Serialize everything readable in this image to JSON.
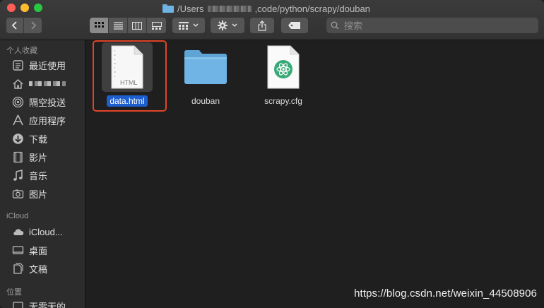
{
  "window": {
    "title_prefix": "/Users",
    "title_suffix": ",code/python/scrapy/douban"
  },
  "toolbar": {
    "back_icon": "chevron-left-icon",
    "forward_icon": "chevron-right-icon",
    "view_modes": [
      "icon-view",
      "list-view",
      "column-view",
      "gallery-view"
    ],
    "active_view": "icon-view",
    "search_placeholder": "搜索"
  },
  "sidebar": {
    "favorites_header": "个人收藏",
    "favorites": [
      {
        "label": "最近使用",
        "icon": "recents-icon"
      },
      {
        "label": "",
        "icon": "home-icon"
      },
      {
        "label": "隔空投送",
        "icon": "airdrop-icon"
      },
      {
        "label": "应用程序",
        "icon": "applications-icon"
      },
      {
        "label": "下载",
        "icon": "downloads-icon"
      },
      {
        "label": "影片",
        "icon": "movies-icon"
      },
      {
        "label": "音乐",
        "icon": "music-icon"
      },
      {
        "label": "图片",
        "icon": "pictures-icon"
      }
    ],
    "icloud_header": "iCloud",
    "icloud": [
      {
        "label": "iCloud...",
        "icon": "icloud-drive-icon"
      },
      {
        "label": "桌面",
        "icon": "desktop-icon"
      },
      {
        "label": "文稿",
        "icon": "documents-icon"
      }
    ],
    "locations_header": "位置",
    "locations": [
      {
        "label": "无零无的",
        "icon": "network-icon"
      }
    ]
  },
  "files": [
    {
      "name": "data.html",
      "type": "html-file",
      "badge": "HTML",
      "selected": true
    },
    {
      "name": "douban",
      "type": "folder",
      "selected": false
    },
    {
      "name": "scrapy.cfg",
      "type": "atom-file",
      "selected": false
    }
  ],
  "watermark": "https://blog.csdn.net/weixin_44508906",
  "colors": {
    "selection": "#1e5fd0",
    "highlight_box": "#e0452a",
    "folder": "#6fb4e4"
  }
}
